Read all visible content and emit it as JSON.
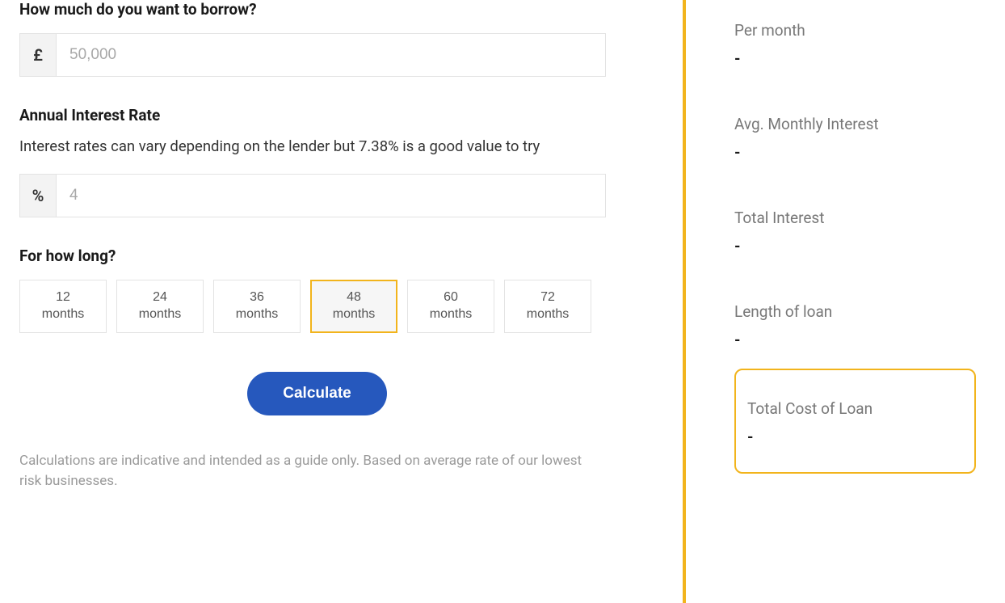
{
  "form": {
    "borrow": {
      "label": "How much do you want to borrow?",
      "prefix": "£",
      "placeholder": "50,000",
      "value": ""
    },
    "rate": {
      "label": "Annual Interest Rate",
      "description": "Interest rates can vary depending on the lender but 7.38% is a good value to try",
      "prefix": "%",
      "placeholder": "4",
      "value": ""
    },
    "duration": {
      "label": "For how long?",
      "unit": "months",
      "options": [
        "12",
        "24",
        "36",
        "48",
        "60",
        "72"
      ],
      "selected_index": 3
    },
    "calculate_label": "Calculate",
    "disclaimer": "Calculations are indicative and intended as a guide only. Based on average rate of our lowest risk businesses."
  },
  "results": {
    "per_month": {
      "label": "Per month",
      "value": "-"
    },
    "avg_monthly_interest": {
      "label": "Avg. Monthly Interest",
      "value": "-"
    },
    "total_interest": {
      "label": "Total Interest",
      "value": "-"
    },
    "length_of_loan": {
      "label": "Length of loan",
      "value": "-"
    },
    "total_cost": {
      "label": "Total Cost of Loan",
      "value": "-"
    }
  }
}
